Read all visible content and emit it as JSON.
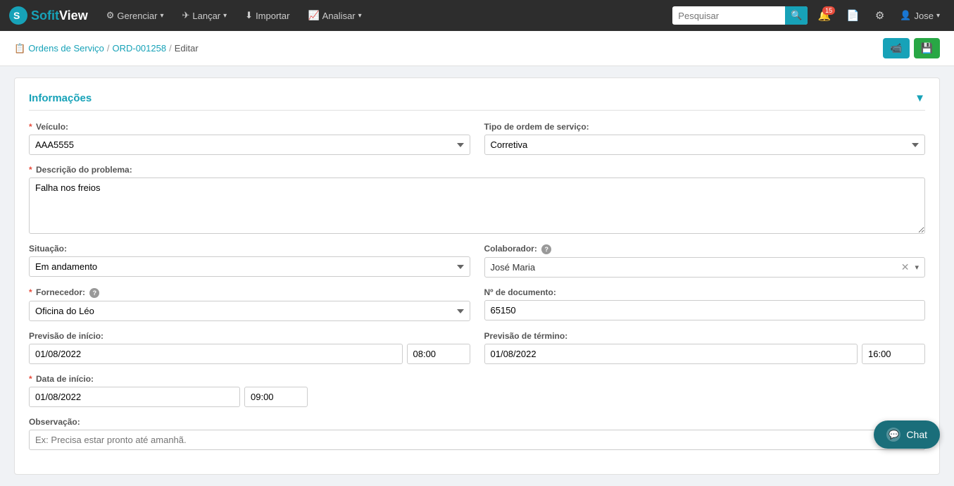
{
  "app": {
    "logo_text_1": "Sofit",
    "logo_text_2": "View"
  },
  "nav": {
    "items": [
      {
        "label": "Gerenciar",
        "icon": "⚙"
      },
      {
        "label": "Lançar",
        "icon": "✈"
      },
      {
        "label": "Importar",
        "icon": "⬇"
      },
      {
        "label": "Analisar",
        "icon": "📈"
      }
    ],
    "search_placeholder": "Pesquisar",
    "notification_count": "15",
    "user_label": "Jose"
  },
  "breadcrumb": {
    "items": [
      {
        "label": "Ordens de Serviço",
        "link": true
      },
      {
        "label": "ORD-001258",
        "link": true
      },
      {
        "label": "Editar",
        "link": false
      }
    ]
  },
  "section": {
    "title": "Informações",
    "collapse_icon": "▼"
  },
  "form": {
    "veiculo_label": "Veículo:",
    "veiculo_required": true,
    "veiculo_value": "AAA5555",
    "tipo_label": "Tipo de ordem de serviço:",
    "tipo_value": "Corretiva",
    "descricao_label": "Descrição do problema:",
    "descricao_required": true,
    "descricao_value": "Falha nos freios",
    "situacao_label": "Situação:",
    "situacao_value": "Em andamento",
    "colaborador_label": "Colaborador:",
    "colaborador_value": "José Maria",
    "fornecedor_label": "Fornecedor:",
    "fornecedor_required": true,
    "fornecedor_value": "Oficina do Léo",
    "documento_label": "Nº de documento:",
    "documento_value": "65150",
    "previsao_inicio_label": "Previsão de início:",
    "previsao_inicio_date": "01/08/2022",
    "previsao_inicio_time": "08:00",
    "previsao_termino_label": "Previsão de término:",
    "previsao_termino_date": "01/08/2022",
    "previsao_termino_time": "16:00",
    "data_inicio_label": "Data de início:",
    "data_inicio_required": true,
    "data_inicio_date": "01/08/2022",
    "data_inicio_time": "09:00",
    "observacao_label": "Observação:",
    "observacao_placeholder": "Ex: Precisa estar pronto até amanhã."
  },
  "chat": {
    "label": "Chat"
  }
}
